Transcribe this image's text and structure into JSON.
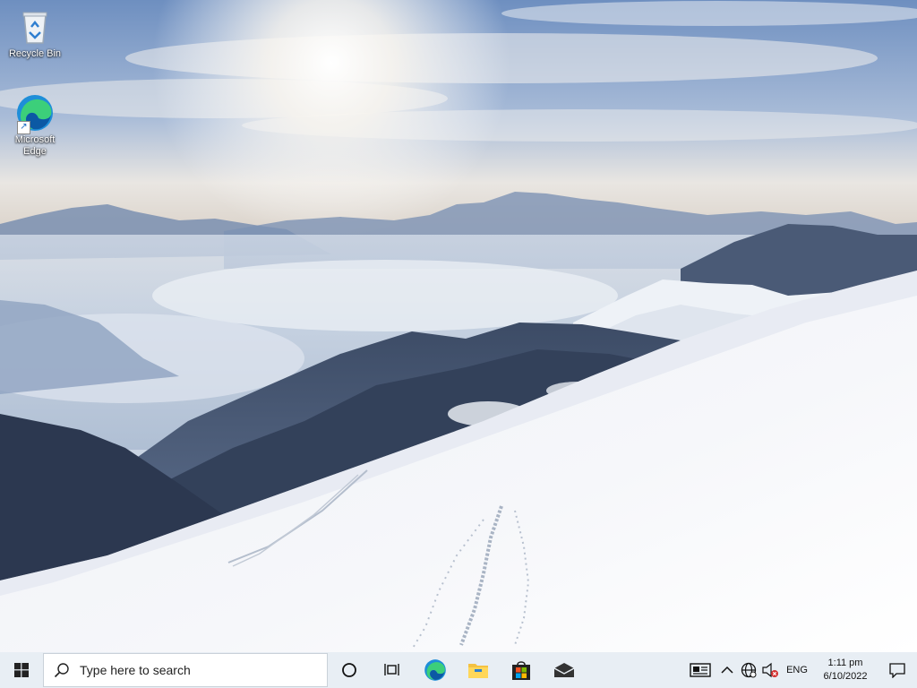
{
  "desktop": {
    "icons": [
      {
        "label": "Recycle Bin",
        "icon": "recycle-bin-icon"
      },
      {
        "label": "Microsoft\nEdge",
        "icon": "edge-icon"
      }
    ]
  },
  "taskbar": {
    "search_placeholder": "Type here to search",
    "pinned": [
      "edge-icon",
      "file-explorer-icon",
      "microsoft-store-icon",
      "mail-icon"
    ],
    "tray": {
      "language": "ENG",
      "time": "1:11 pm",
      "date": "6/10/2022"
    }
  },
  "colors": {
    "taskbar_bg": "#e8eef4",
    "sky_top": "#6e8fc0",
    "snow": "#f4f6f9"
  }
}
